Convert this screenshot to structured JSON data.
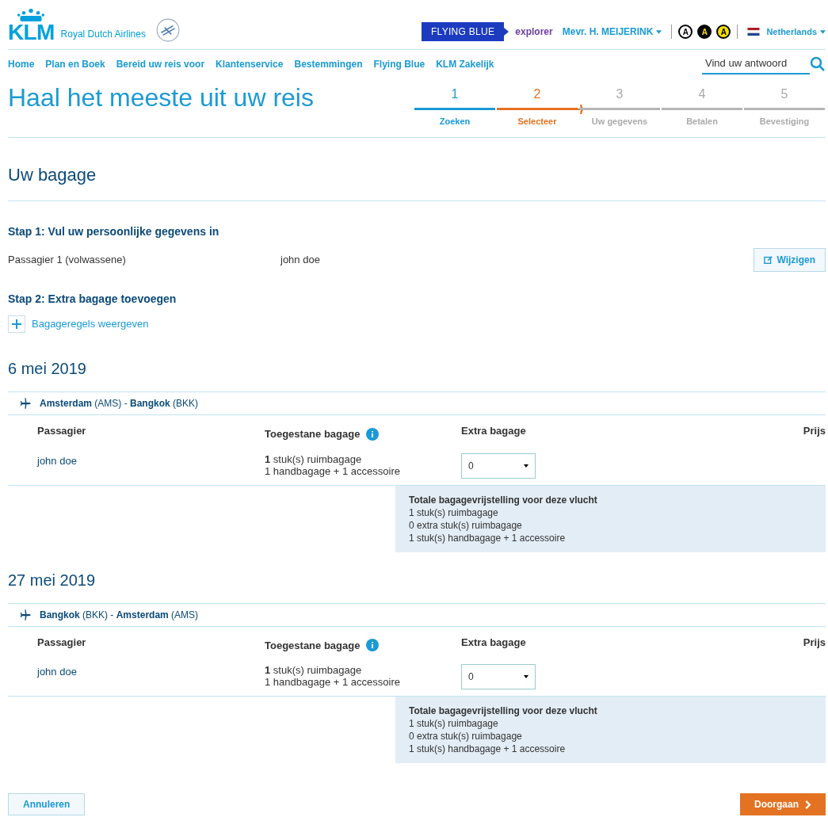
{
  "header": {
    "logo": "KLM",
    "tagline": "Royal Dutch Airlines",
    "flying_blue": "FLYING BLUE",
    "tier": "explorer",
    "user": "Mevr. H. MEIJERINK",
    "contrast": [
      {
        "label": "A",
        "kind": "outline"
      },
      {
        "label": "A",
        "kind": "dark"
      },
      {
        "label": "A",
        "kind": "yellow"
      }
    ],
    "country": "Netherlands"
  },
  "nav": {
    "items": [
      "Home",
      "Plan en Boek",
      "Bereid uw reis voor",
      "Klantenservice",
      "Bestemmingen",
      "Flying Blue",
      "KLM Zakelijk"
    ],
    "search": {
      "value": "Vind uw antwoord"
    }
  },
  "title": "Haal het meeste uit uw reis",
  "steps": [
    {
      "number": "1",
      "label": "Zoeken",
      "done": true,
      "selected": false
    },
    {
      "number": "2",
      "label": "Selecteer",
      "done": false,
      "selected": true
    },
    {
      "number": "3",
      "label": "Uw gegevens",
      "done": false,
      "selected": false
    },
    {
      "number": "4",
      "label": "Betalen",
      "done": false,
      "selected": false
    },
    {
      "number": "5",
      "label": "Bevestiging",
      "done": false,
      "selected": false
    }
  ],
  "section_title": "Uw bagage",
  "step1": {
    "heading": "Stap 1: Vul uw persoonlijke gegevens in",
    "passenger_label": "Passagier 1 (volwassene)",
    "passenger_name": "john doe",
    "edit_button": "Wijzigen"
  },
  "step2": {
    "heading": "Stap 2: Extra bagage toevoegen",
    "toggle": "Bagageregels weergeven",
    "expanded": false
  },
  "flights": [
    {
      "date": "6 mei 2019",
      "route": "**Amsterdam** (AMS) - **Bangkok** (BKK)",
      "columns": [
        "Passagier",
        "Toegestane bagage",
        "Extra bagage",
        "Prijs"
      ],
      "passenger": "john doe",
      "allowance": [
        "**1** stuk(s) ruimbagage",
        "1 handbagage + 1 accessoire"
      ],
      "extra": "0",
      "summary_title": "Totale bagagevrijstelling voor deze vlucht",
      "summary": [
        "1 stuk(s) ruimbagage",
        "0 extra stuk(s) ruimbagage",
        "1 stuk(s) handbagage + 1 accessoire"
      ]
    },
    {
      "date": "27 mei 2019",
      "route": "**Bangkok** (BKK) - **Amsterdam** (AMS)",
      "columns": [
        "Passagier",
        "Toegestane bagage",
        "Extra bagage",
        "Prijs"
      ],
      "passenger": "john doe",
      "allowance": [
        "**1** stuk(s) ruimbagage",
        "1 handbagage + 1 accessoire"
      ],
      "extra": "0",
      "summary_title": "Totale bagagevrijstelling voor deze vlucht",
      "summary": [
        "1 stuk(s) ruimbagage",
        "0 extra stuk(s) ruimbagage",
        "1 stuk(s) handbagage + 1 accessoire"
      ]
    }
  ],
  "footer": {
    "cancel": "Annuleren",
    "continue": "Doorgaan"
  }
}
